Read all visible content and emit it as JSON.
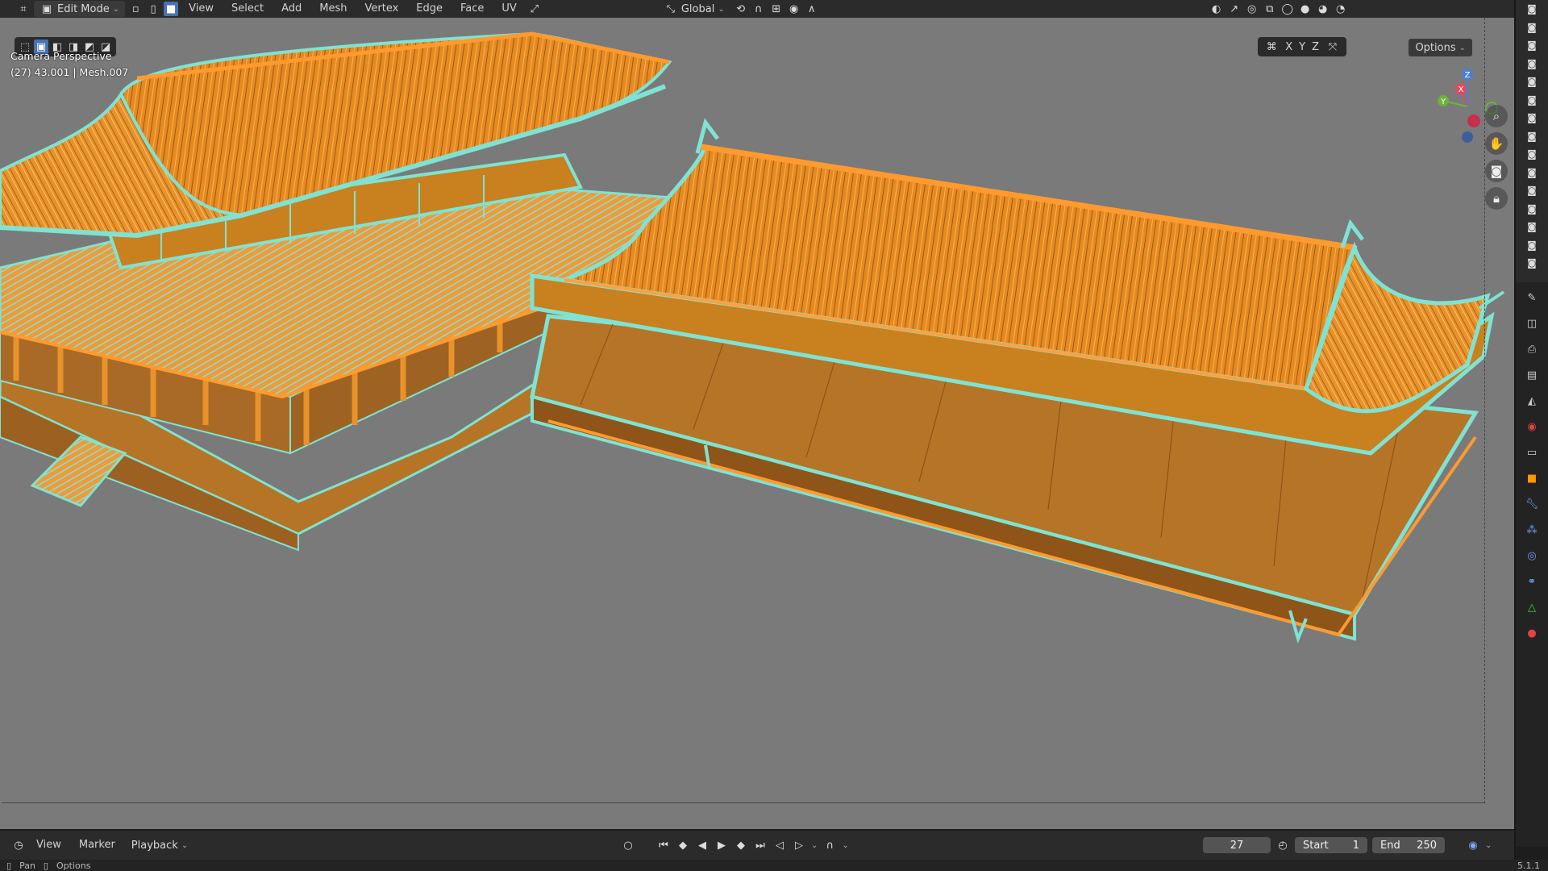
{
  "header": {
    "mode": "Edit Mode",
    "menus": [
      "View",
      "Select",
      "Add",
      "Mesh",
      "Vertex",
      "Edge",
      "Face",
      "UV"
    ],
    "orientation": "Global",
    "options": "Options"
  },
  "viewport": {
    "camera_label": "Camera Perspective",
    "object_info": "(27) 43.001 | Mesh.007",
    "axes": [
      "X",
      "Y",
      "Z"
    ],
    "gizmo_axes": {
      "x": "X",
      "y": "Y",
      "z": "Z"
    },
    "colors": {
      "background": "#7a7a7a",
      "mesh_fill": "#c9801f",
      "wire": "#7fe3d3",
      "edge": "#ff9a2e"
    }
  },
  "timeline": {
    "menus": [
      "View",
      "Marker",
      "Playback"
    ],
    "current_frame": "27",
    "start_label": "Start",
    "start_value": "1",
    "end_label": "End",
    "end_value": "250"
  },
  "statusbar": {
    "left_action": "Pan",
    "right_action": "Options",
    "version": "5.1.1"
  }
}
